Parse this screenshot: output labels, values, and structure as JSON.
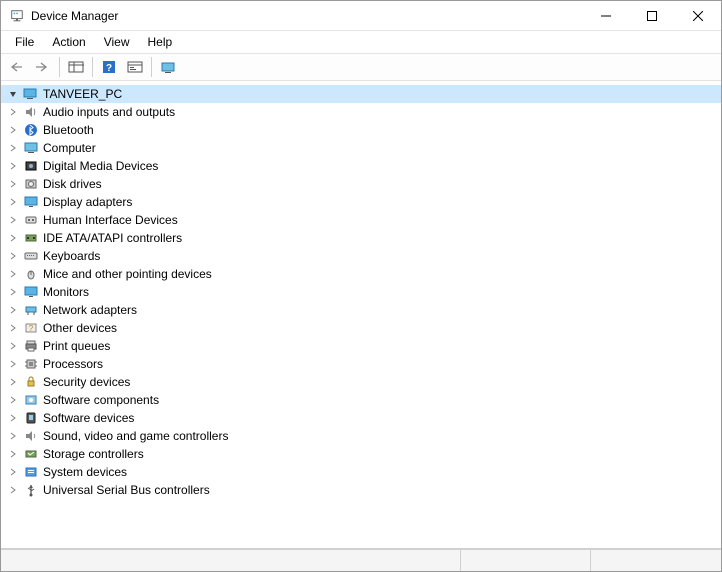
{
  "window": {
    "title": "Device Manager"
  },
  "menu": {
    "file": "File",
    "action": "Action",
    "view": "View",
    "help": "Help"
  },
  "tree": {
    "root": "TANVEER_PC",
    "items": [
      {
        "label": "Audio inputs and outputs",
        "icon": "audio-icon"
      },
      {
        "label": "Bluetooth",
        "icon": "bluetooth-icon"
      },
      {
        "label": "Computer",
        "icon": "computer-icon"
      },
      {
        "label": "Digital Media Devices",
        "icon": "media-device-icon"
      },
      {
        "label": "Disk drives",
        "icon": "disk-icon"
      },
      {
        "label": "Display adapters",
        "icon": "display-icon"
      },
      {
        "label": "Human Interface Devices",
        "icon": "hid-icon"
      },
      {
        "label": "IDE ATA/ATAPI controllers",
        "icon": "ide-icon"
      },
      {
        "label": "Keyboards",
        "icon": "keyboard-icon"
      },
      {
        "label": "Mice and other pointing devices",
        "icon": "mouse-icon"
      },
      {
        "label": "Monitors",
        "icon": "monitor-icon"
      },
      {
        "label": "Network adapters",
        "icon": "network-icon"
      },
      {
        "label": "Other devices",
        "icon": "other-icon"
      },
      {
        "label": "Print queues",
        "icon": "printer-icon"
      },
      {
        "label": "Processors",
        "icon": "processor-icon"
      },
      {
        "label": "Security devices",
        "icon": "security-icon"
      },
      {
        "label": "Software components",
        "icon": "software-comp-icon"
      },
      {
        "label": "Software devices",
        "icon": "software-dev-icon"
      },
      {
        "label": "Sound, video and game controllers",
        "icon": "sound-icon"
      },
      {
        "label": "Storage controllers",
        "icon": "storage-icon"
      },
      {
        "label": "System devices",
        "icon": "system-icon"
      },
      {
        "label": "Universal Serial Bus controllers",
        "icon": "usb-icon"
      }
    ]
  }
}
